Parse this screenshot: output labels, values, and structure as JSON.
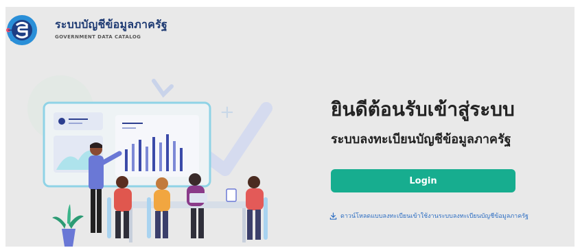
{
  "header": {
    "brand_title": "ระบบบัญชีข้อมูลภาครัฐ",
    "brand_subtitle": "GOVERNMENT DATA CATALOG",
    "logo_icon": "gdc-logo-icon"
  },
  "main": {
    "welcome_title": "ยินดีต้อนรับเข้าสู่ระบบ",
    "subtitle": "ระบบลงทะเบียนบัญชีข้อมูลภาครัฐ",
    "login_label": "Login",
    "download_icon": "download-icon",
    "download_link": "ดาวน์โหลดแบบลงทะเบียนเข้าใช้งานระบบลงทะเบียนบัญชีข้อมูลภาครัฐ"
  },
  "colors": {
    "background": "#e9e9e9",
    "accent": "#17ad8f",
    "brand": "#1f3b73",
    "link": "#2c6dc2"
  }
}
